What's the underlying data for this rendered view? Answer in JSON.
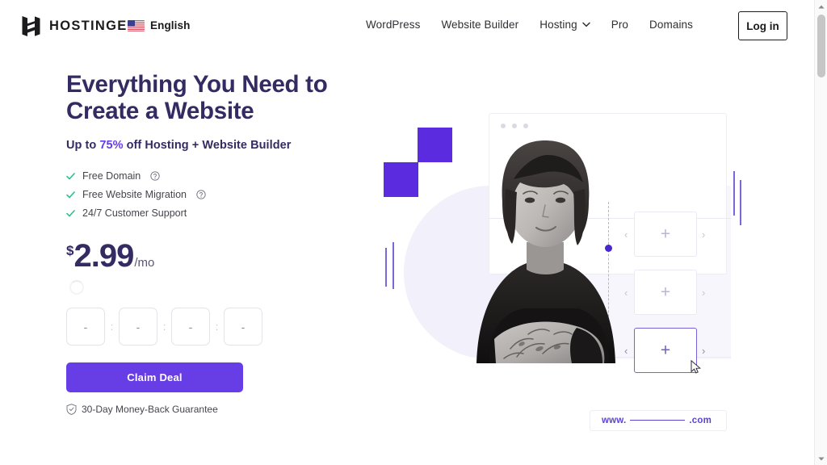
{
  "header": {
    "brand_name": "HOSTINGER",
    "logo_icon": "hostinger-h-logo",
    "language": {
      "flag_icon": "us-flag-icon",
      "label": "English"
    },
    "nav_items": [
      {
        "label": "WordPress",
        "has_chevron": false
      },
      {
        "label": "Website Builder",
        "has_chevron": false
      },
      {
        "label": "Hosting",
        "has_chevron": true
      },
      {
        "label": "Pro",
        "has_chevron": false
      },
      {
        "label": "Domains",
        "has_chevron": false
      }
    ],
    "login_label": "Log in",
    "chevron_icon": "chevron-down-icon"
  },
  "hero": {
    "headline": "Everything You Need to Create a Website",
    "subheadline_prefix": "Up to ",
    "subheadline_accent": "75%",
    "subheadline_suffix": " off Hosting + Website Builder",
    "features": [
      {
        "label": "Free Domain",
        "has_help": true
      },
      {
        "label": "Free Website Migration",
        "has_help": true
      },
      {
        "label": "24/7 Customer Support",
        "has_help": false
      }
    ],
    "check_icon": "check-icon",
    "help_icon": "question-mark-circle-icon",
    "price": {
      "currency": "$",
      "amount": "2.99",
      "period": "/mo"
    },
    "loading_spinner": "loading-spinner-icon",
    "countdown": {
      "separator": ":",
      "units": [
        "-",
        "-",
        "-",
        "-"
      ]
    },
    "cta_label": "Claim Deal",
    "guarantee_label": "30-Day Money-Back Guarantee",
    "guarantee_icon": "shield-check-icon"
  },
  "illustration": {
    "browser_dots_icon": "window-dots-icon",
    "placeholder_icon": "plus-icon",
    "arrow_left_icon": "chevron-left-icon",
    "arrow_right_icon": "chevron-right-icon",
    "cursor_icon": "mouse-cursor-icon",
    "person_photo": "woman-with-tattoos-photo",
    "domain_bar": {
      "prefix": "www.",
      "suffix": ".com"
    },
    "cards": [
      {
        "selected": false
      },
      {
        "selected": false
      },
      {
        "selected": true
      }
    ]
  },
  "scrollbar": {
    "up_icon": "scroll-up-arrow-icon",
    "down_icon": "scroll-down-arrow-icon",
    "thumb": "scrollbar-thumb"
  },
  "colors": {
    "brand_purple": "#673de6",
    "deep_purple": "#342b63",
    "square_purple": "#5b2be0",
    "check_green": "#2ec08b",
    "blob_lavender": "#f2f1fb"
  }
}
